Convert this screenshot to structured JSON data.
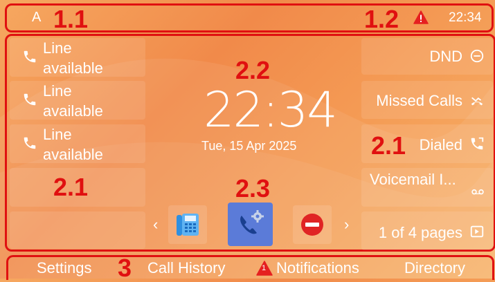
{
  "status_bar": {
    "account_letter": "A",
    "time": "22:34"
  },
  "line_keys_left": [
    {
      "label": "Line available"
    },
    {
      "label": "Line available"
    },
    {
      "label": "Line available"
    }
  ],
  "line_keys_right": [
    {
      "label": "DND"
    },
    {
      "label": "Missed Calls"
    },
    {
      "label": "Dialed"
    },
    {
      "label": "Voicemail I..."
    },
    {
      "label": "1 of 4 pages"
    }
  ],
  "idle": {
    "time": "22:34",
    "date": "Tue, 15 Apr 2025"
  },
  "soft_keys": {
    "settings": "Settings",
    "call_history": "Call History",
    "notifications": "Notifications",
    "notifications_badge": "1",
    "directory": "Directory"
  },
  "annotations": {
    "a_1_1": "1.1",
    "a_1_2": "1.2",
    "a_2_2": "2.2",
    "a_2_1_left": "2.1",
    "a_2_1_right": "2.1",
    "a_2_3": "2.3",
    "a_3": "3"
  },
  "colors": {
    "annotation": "#e01010",
    "warning": "#e52020",
    "active_app": "#5b7bd8"
  }
}
